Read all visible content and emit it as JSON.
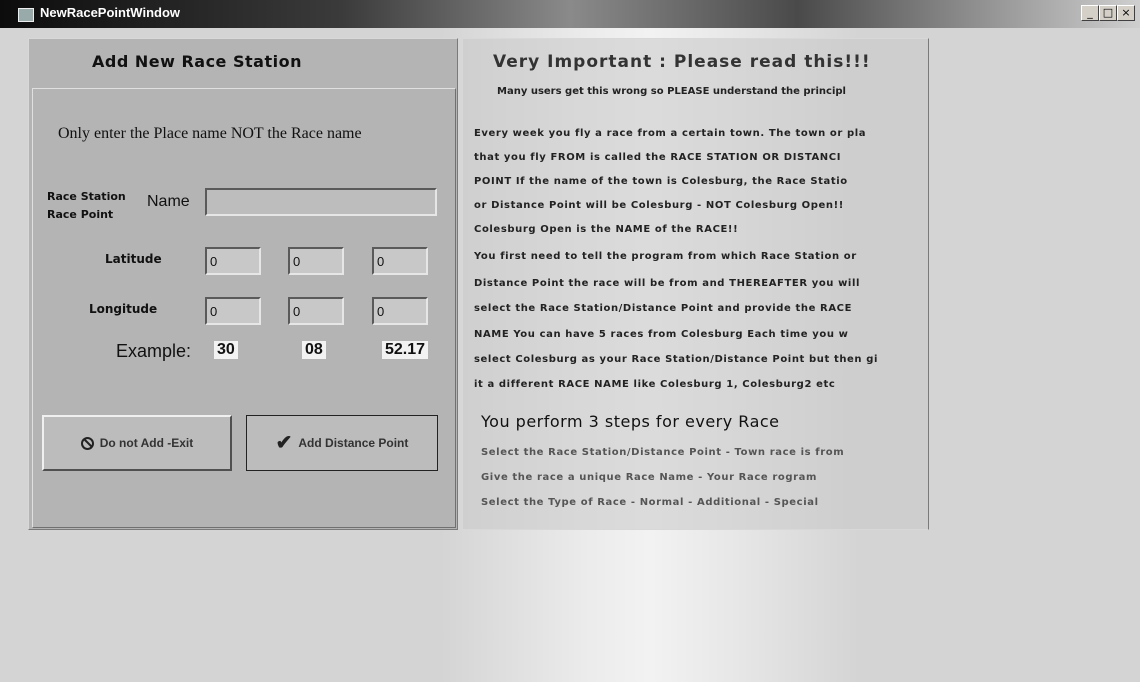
{
  "window": {
    "title": "NewRacePointWindow",
    "controls": {
      "minimize": "_",
      "maximize": "□",
      "close": "×"
    }
  },
  "form": {
    "section_title": "Add New Race Station",
    "instruction": "Only enter the Place name NOT the Race name",
    "station_label_1": "Race Station",
    "station_label_2": "Race Point",
    "name_label": "Name",
    "name_value": "",
    "latitude_label": "Latitude",
    "latitude": [
      "0",
      "0",
      "0"
    ],
    "longitude_label": "Longitude",
    "longitude": [
      "0",
      "0",
      "0"
    ],
    "example_label": "Example:",
    "example": [
      "30",
      "08",
      "52.17"
    ],
    "exit_button": "Do not Add -Exit",
    "add_button": "Add Distance Point"
  },
  "help": {
    "title": "Very Important :  Please read this!!!",
    "subtitle": "Many users get this wrong so PLEASE understand the principl",
    "lines": [
      "Every week you fly a race from a certain town. The town or pla",
      "that you fly FROM is called the RACE STATION OR DISTANCI",
      "POINT  If the name of the town is Colesburg, the Race Statio",
      "or Distance Point will be Colesburg - NOT Colesburg Open!!",
      "Colesburg Open is the NAME of the RACE!!",
      "You first need to tell the program from which Race Station or",
      "Distance Point the race will be from and THEREAFTER you will",
      "select the Race Station/Distance Point and provide the RACE",
      "NAME  You can have 5 races from Colesburg  Each time you w",
      "select Colesburg as your Race Station/Distance Point but then gi",
      "it a different RACE NAME like Colesburg 1, Colesburg2 etc"
    ],
    "steps_title": "You perform 3 steps for every Race",
    "steps": [
      "Select the Race Station/Distance Point - Town race is from",
      "Give the race a unique Race Name - Your Race rogram",
      "Select the Type of Race - Normal -  Additional - Special"
    ]
  }
}
